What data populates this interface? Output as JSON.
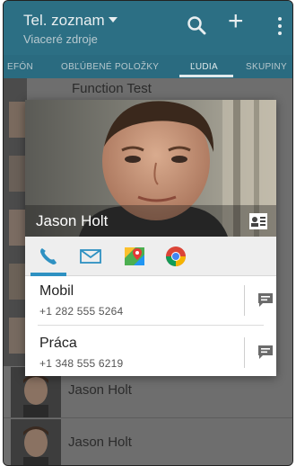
{
  "appbar": {
    "title": "Tel. zoznam",
    "subtitle": "Viaceré zdroje"
  },
  "tabs": [
    {
      "label": "EFÓN"
    },
    {
      "label": "OBĽÚBENÉ POLOŽKY"
    },
    {
      "label": "ĽUDIA"
    },
    {
      "label": "SKUPINY"
    }
  ],
  "list": {
    "top_item": "Function Test",
    "rows": [
      {
        "name": "Jason Holt"
      },
      {
        "name": "Jason Holt"
      }
    ]
  },
  "card": {
    "name": "Jason Holt",
    "quick_actions": [
      {
        "icon": "phone-icon"
      },
      {
        "icon": "mail-icon"
      },
      {
        "icon": "maps-icon"
      },
      {
        "icon": "chrome-icon"
      }
    ],
    "entries": [
      {
        "label": "Mobil",
        "number": "+1 282 555 5264"
      },
      {
        "label": "Práca",
        "number": "+1 348 555 6219"
      }
    ]
  },
  "colors": {
    "appbar": "#2c6f84",
    "accent": "#2e91c2"
  }
}
